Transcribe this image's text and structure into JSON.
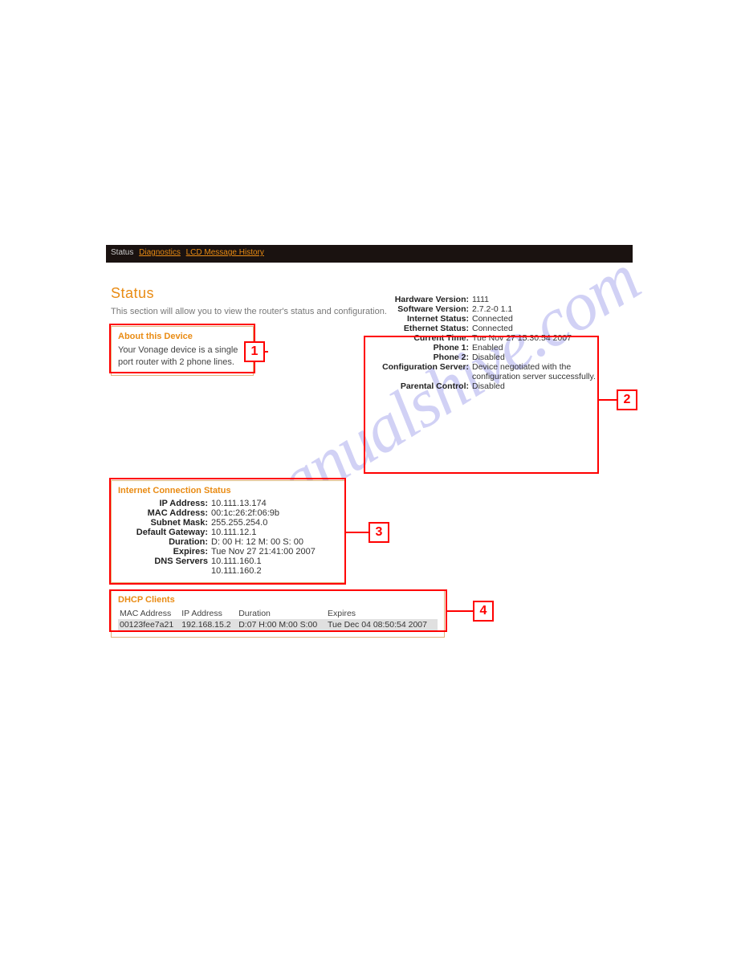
{
  "nav": {
    "status": "Status",
    "diagnostics": "Diagnostics",
    "lcd": "LCD Message History"
  },
  "page_title": "Status",
  "subtitle": "This section will allow you to view the router's status and configuration.",
  "about": {
    "heading": "About this Device",
    "text": "Your Vonage device is a single port router with 2 phone lines."
  },
  "info": {
    "hardware_version_l": "Hardware Version:",
    "hardware_version_v": "1111",
    "software_version_l": "Software Version:",
    "software_version_v": "2.7.2-0 1.1",
    "internet_status_l": "Internet Status:",
    "internet_status_v": "Connected",
    "ethernet_status_l": "Ethernet Status:",
    "ethernet_status_v": "Connected",
    "current_time_l": "Current Time:",
    "current_time_v": "Tue Nov 27 15:30:54 2007",
    "phone1_l": "Phone 1:",
    "phone1_v": "Enabled",
    "phone2_l": "Phone 2:",
    "phone2_v": "Disabled",
    "config_server_l": "Configuration Server:",
    "config_server_v": "Device negotiated with the configuration server successfully.",
    "parental_l": "Parental Control:",
    "parental_v": "Disabled"
  },
  "ics": {
    "heading": "Internet Connection Status",
    "ip_l": "IP Address:",
    "ip_v": "10.111.13.174",
    "mac_l": "MAC Address:",
    "mac_v": "00:1c:26:2f:06:9b",
    "subnet_l": "Subnet Mask:",
    "subnet_v": "255.255.254.0",
    "gateway_l": "Default Gateway:",
    "gateway_v": "10.111.12.1",
    "duration_l": "Duration:",
    "duration_v": "D: 00 H: 12 M: 00 S: 00",
    "expires_l": "Expires:",
    "expires_v": "Tue Nov 27 21:41:00 2007",
    "dns_l": "DNS Servers",
    "dns_v1": "10.111.160.1",
    "dns_v2": "10.111.160.2"
  },
  "dhcp": {
    "heading": "DHCP Clients",
    "cols": {
      "mac": "MAC Address",
      "ip": "IP Address",
      "dur": "Duration",
      "exp": "Expires"
    },
    "rows": [
      {
        "mac": "00123fee7a21",
        "ip": "192.168.15.2",
        "dur": "D:07 H:00 M:00 S:00",
        "exp": "Tue Dec 04 08:50:54 2007"
      }
    ]
  },
  "callouts": {
    "c1": "1",
    "c2": "2",
    "c3": "3",
    "c4": "4"
  },
  "watermark": "manualshive.com"
}
